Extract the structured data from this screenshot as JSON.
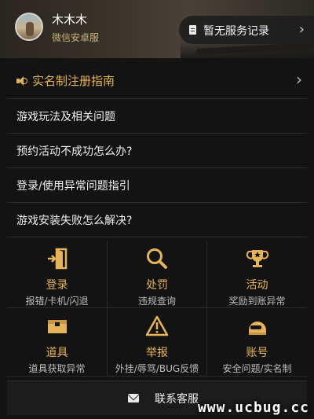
{
  "header": {
    "username": "木木木",
    "subtitle": "微信安卓服",
    "service_record": "暂无服务记录"
  },
  "list": {
    "guide": "实名制注册指南",
    "items": [
      "游戏玩法及相关问题",
      "预约活动不成功怎么办?",
      "登录/使用异常问题指引",
      "游戏安装失败怎么解决?"
    ]
  },
  "grid": [
    {
      "title": "登录",
      "desc": "报错/卡机/闪退",
      "icon": "door-login-icon"
    },
    {
      "title": "处罚",
      "desc": "违规查询",
      "icon": "magnifier-icon"
    },
    {
      "title": "活动",
      "desc": "奖励到账异常",
      "icon": "trophy-icon"
    },
    {
      "title": "道具",
      "desc": "道具获取异常",
      "icon": "crate-icon"
    },
    {
      "title": "举报",
      "desc": "外挂/辱骂/BUG反馈",
      "icon": "warning-icon"
    },
    {
      "title": "账号",
      "desc": "安全问题/实名制",
      "icon": "helmet-icon"
    }
  ],
  "contact": {
    "label": "联系客服"
  },
  "watermark": "www.ucbug.cc",
  "colors": {
    "accent": "#e5b45a",
    "background": "#131313"
  }
}
